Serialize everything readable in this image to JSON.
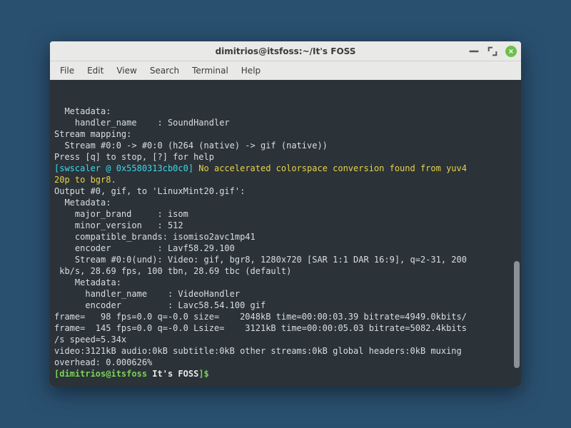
{
  "window": {
    "title": "dimitrios@itsfoss:~/It's FOSS"
  },
  "menubar": {
    "items": [
      "File",
      "Edit",
      "View",
      "Search",
      "Terminal",
      "Help"
    ]
  },
  "terminal": {
    "lines": [
      [
        {
          "t": "dim",
          "v": "  Metadata:"
        }
      ],
      [
        {
          "t": "dim",
          "v": "    handler_name    : SoundHandler"
        }
      ],
      [
        {
          "t": "dim",
          "v": "Stream mapping:"
        }
      ],
      [
        {
          "t": "dim",
          "v": "  Stream #0:0 -> #0:0 (h264 (native) -> gif (native))"
        }
      ],
      [
        {
          "t": "dim",
          "v": "Press [q] to stop, [?] for help"
        }
      ],
      [
        {
          "t": "cyan",
          "v": "[swscaler @ 0x5580313cb0c0] "
        },
        {
          "t": "yellow",
          "v": "No accelerated colorspace conversion found from yuv4"
        }
      ],
      [
        {
          "t": "yellow",
          "v": "20p to bgr8."
        }
      ],
      [
        {
          "t": "dim",
          "v": "Output #0, gif, to 'LinuxMint20.gif':"
        }
      ],
      [
        {
          "t": "dim",
          "v": "  Metadata:"
        }
      ],
      [
        {
          "t": "dim",
          "v": "    major_brand     : isom"
        }
      ],
      [
        {
          "t": "dim",
          "v": "    minor_version   : 512"
        }
      ],
      [
        {
          "t": "dim",
          "v": "    compatible_brands: isomiso2avc1mp41"
        }
      ],
      [
        {
          "t": "dim",
          "v": "    encoder         : Lavf58.29.100"
        }
      ],
      [
        {
          "t": "dim",
          "v": "    Stream #0:0(und): Video: gif, bgr8, 1280x720 [SAR 1:1 DAR 16:9], q=2-31, 200"
        }
      ],
      [
        {
          "t": "dim",
          "v": " kb/s, 28.69 fps, 100 tbn, 28.69 tbc (default)"
        }
      ],
      [
        {
          "t": "dim",
          "v": "    Metadata:"
        }
      ],
      [
        {
          "t": "dim",
          "v": "      handler_name    : VideoHandler"
        }
      ],
      [
        {
          "t": "dim",
          "v": "      encoder         : Lavc58.54.100 gif"
        }
      ],
      [
        {
          "t": "dim",
          "v": "frame=   98 fps=0.0 q=-0.0 size=    2048kB time=00:00:03.39 bitrate=4949.0kbits/"
        }
      ],
      [
        {
          "t": "dim",
          "v": "frame=  145 fps=0.0 q=-0.0 Lsize=    3121kB time=00:00:05.03 bitrate=5082.4kbits"
        }
      ],
      [
        {
          "t": "dim",
          "v": "/s speed=5.34x"
        }
      ],
      [
        {
          "t": "dim",
          "v": "video:3121kB audio:0kB subtitle:0kB other streams:0kB global headers:0kB muxing "
        }
      ],
      [
        {
          "t": "dim",
          "v": "overhead: 0.000626%"
        }
      ],
      [
        {
          "t": "green",
          "v": "[dimitrios@itsfoss "
        },
        {
          "t": "white",
          "v": "It's FOSS"
        },
        {
          "t": "green",
          "v": "]$ "
        }
      ]
    ]
  }
}
